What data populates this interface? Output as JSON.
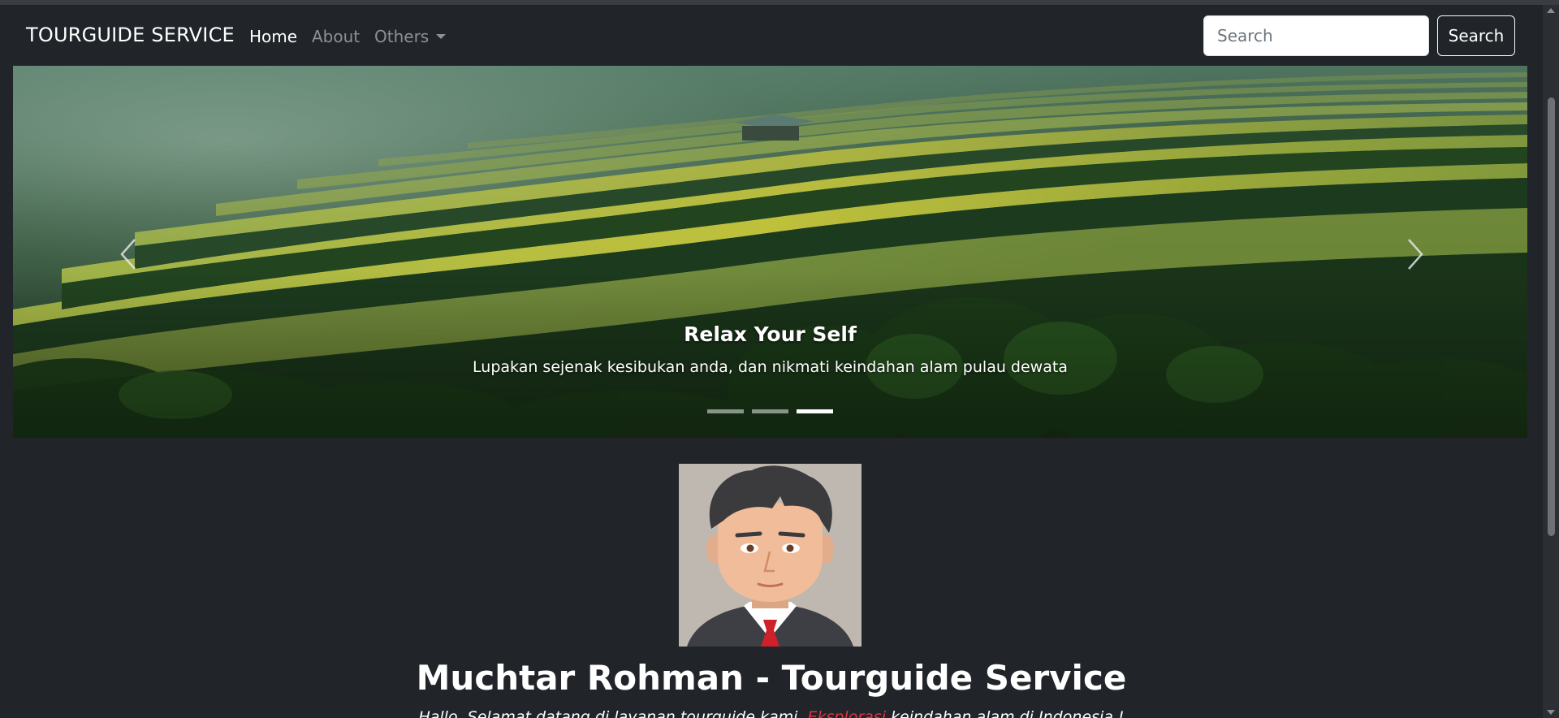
{
  "navbar": {
    "brand": "TOURGUIDE SERVICE",
    "links": [
      {
        "label": "Home",
        "active": true
      },
      {
        "label": "About",
        "active": false
      },
      {
        "label": "Others",
        "active": false,
        "dropdown": true
      }
    ],
    "search": {
      "placeholder": "Search",
      "value": "",
      "button_label": "Search"
    }
  },
  "carousel": {
    "caption_title": "Relax Your Self",
    "caption_text": "Lupakan sejenak kesibukan anda, dan nikmati keindahan alam pulau dewata",
    "slide_count": 3,
    "active_index": 3,
    "prev_icon": "chevron-left-icon",
    "next_icon": "chevron-right-icon"
  },
  "profile": {
    "avatar_alt": "avatar",
    "headline": "Muchtar Rohman - Tourguide Service",
    "intro_before": "Hallo, Selamat datang di layanan tourguide kami, ",
    "intro_highlight": "Eksplorasi",
    "intro_after": " keindahan alam di Indonesia !"
  },
  "colors": {
    "background": "#212529",
    "accent": "#dc3545",
    "text": "#ffffff",
    "muted": "#8c9196"
  }
}
